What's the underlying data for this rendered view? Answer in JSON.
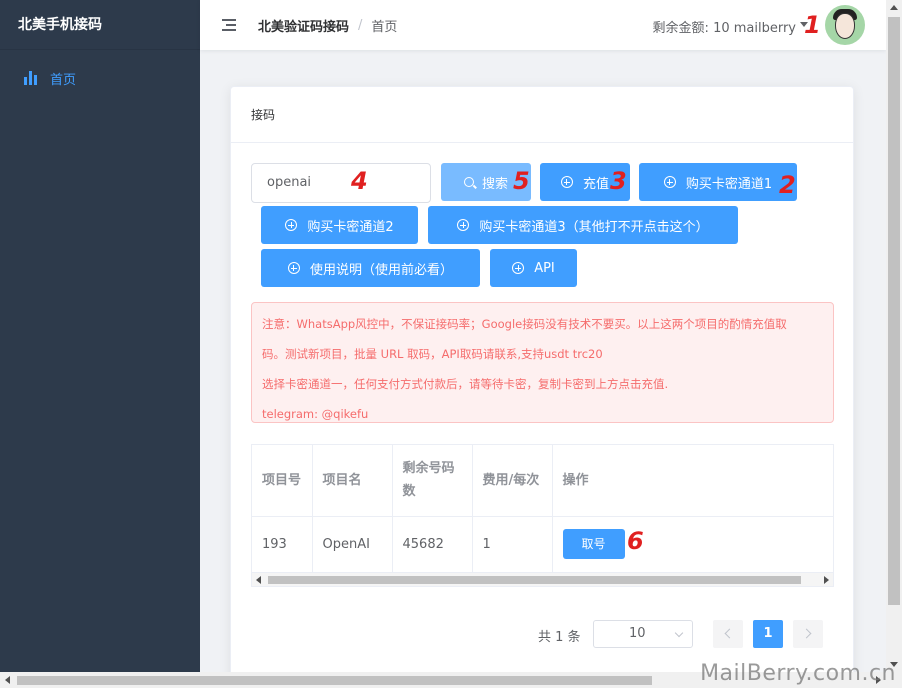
{
  "sidebar": {
    "brand": "北美手机接码",
    "items": [
      {
        "label": "首页",
        "icon": "bar-chart-icon",
        "active": true
      }
    ]
  },
  "header": {
    "breadcrumb_home": "北美验证码接码",
    "breadcrumb_sep": "/",
    "breadcrumb_current": "首页",
    "balance_label": "剩余金额:",
    "balance_value": "10 mailberry"
  },
  "card": {
    "title": "接码",
    "search_value": "openai",
    "buttons": {
      "search": "搜索",
      "recharge": "充值",
      "buy1": "购买卡密通道1",
      "buy2": "购买卡密通道2",
      "buy3": "购买卡密通道3（其他打不开点击这个）",
      "instructions": "使用说明（使用前必看）",
      "api": "API"
    },
    "notice": [
      "注意：WhatsApp风控中，不保证接码率；Google接码没有技术不要买。以上这两个项目的酌情充值取",
      "码。测试新项目，批量 URL 取码，API取码请联系,支持usdt trc20",
      "选择卡密通道一，任何支付方式付款后，请等待卡密，复制卡密到上方点击充值.",
      "telegram: @qikefu"
    ]
  },
  "table": {
    "headers": [
      "项目号",
      "项目名",
      "剩余号码数",
      "费用/每次",
      "操作"
    ],
    "rows": [
      {
        "id": "193",
        "name": "OpenAI",
        "remaining": "45682",
        "fee": "1",
        "action": "取号"
      }
    ]
  },
  "pagination": {
    "total": "共 1 条",
    "page_size": "10",
    "current_page": "1"
  },
  "markers": [
    "1",
    "2",
    "3",
    "4",
    "5",
    "6"
  ],
  "watermark": "MailBerry.com.cn",
  "colors": {
    "primary": "#409eff",
    "sidebar": "#2d3a4b",
    "alert_text": "#f56c6c",
    "marker": "#e02020"
  }
}
